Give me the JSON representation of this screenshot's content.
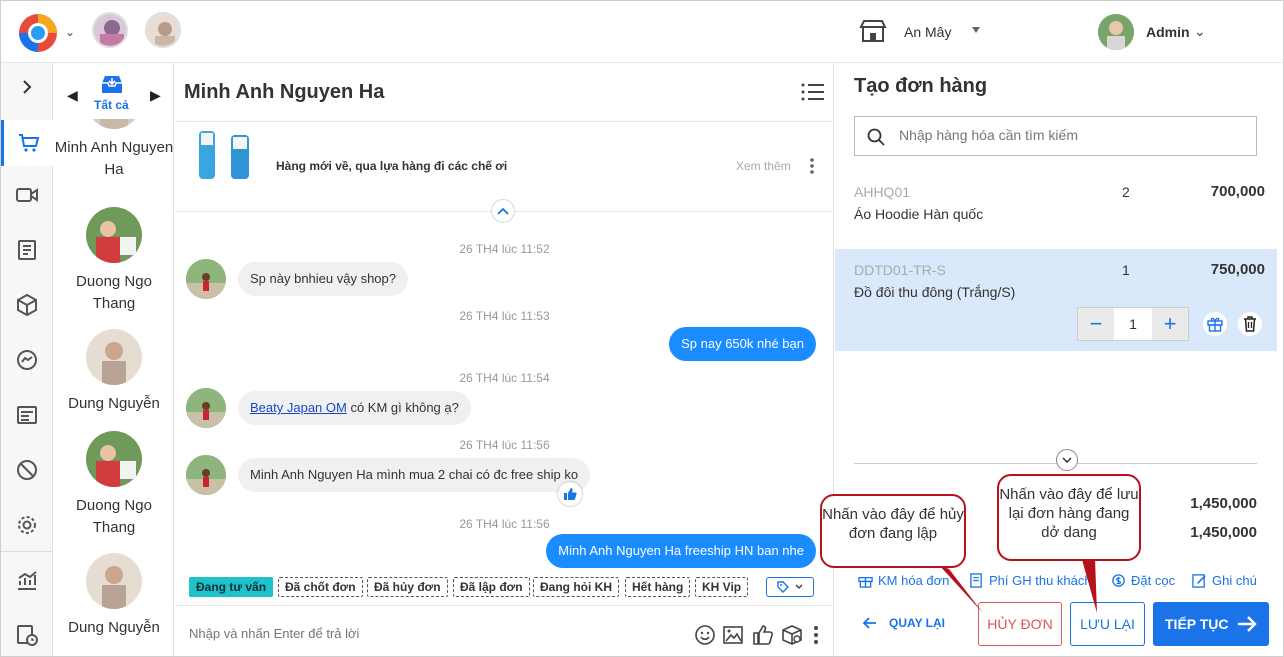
{
  "header": {
    "store_name": "An Mây",
    "admin_name": "Admin"
  },
  "conversations": {
    "filter_label": "Tất cả",
    "items": [
      {
        "name": "Minh Anh Nguyen Ha"
      },
      {
        "name": "Duong Ngo Thang"
      },
      {
        "name": "Dung Nguyễn"
      },
      {
        "name": "Duong Ngo Thang"
      },
      {
        "name": "Dung Nguyễn"
      }
    ]
  },
  "chat": {
    "title": "Minh Anh Nguyen Ha",
    "post_text": "Hàng mới về, qua lựa hàng đi các chế ơi",
    "post_more": "Xem thêm",
    "messages": [
      {
        "time": "26 TH4 lúc 11:52",
        "text": "Sp này bnhieu vậy shop?"
      },
      {
        "time": "26 TH4 lúc 11:53",
        "text": "Sp nay 650k nhé bạn"
      },
      {
        "time": "26 TH4 lúc 11:54",
        "link": "Beaty Japan OM",
        "text": "có KM gì không ạ?"
      },
      {
        "time": "26 TH4 lúc 11:56",
        "text": "Minh Anh Nguyen Ha mình mua 2 chai có đc free ship ko"
      },
      {
        "time": "26 TH4 lúc 11:56",
        "text": "Minh Anh Nguyen Ha freeship HN ban nhe"
      }
    ],
    "tags": [
      "Đang tư vấn",
      "Đã chốt đơn",
      "Đã hủy đơn",
      "Đã lập đơn",
      "Đang hỏi KH",
      "Hết hàng",
      "KH Vip"
    ],
    "reply_placeholder": "Nhập và nhấn Enter để trả lời"
  },
  "order": {
    "title": "Tạo đơn hàng",
    "search_placeholder": "Nhập hàng hóa cần tìm kiếm",
    "products": [
      {
        "code": "AHHQ01",
        "name": "Áo Hoodie Hàn quốc",
        "qty": "2",
        "price": "700,000"
      },
      {
        "code": "DDTD01-TR-S",
        "name": "Đồ đôi thu đông (Trắng/S)",
        "qty": "1",
        "price": "750,000"
      }
    ],
    "stepper_value": "1",
    "totals": [
      "1,450,000",
      "1,450,000"
    ],
    "options": {
      "promo": "KM hóa đơn",
      "shipping": "Phí GH thu khách",
      "deposit": "Đặt cọc",
      "note": "Ghi chú"
    },
    "back_label": "QUAY LẠI",
    "cancel_label": "HỦY ĐƠN",
    "save_label": "LƯU LẠI",
    "next_label": "TIẾP TỤC"
  },
  "callouts": {
    "cancel_hint": "Nhấn vào đây để hủy đơn đang lập",
    "save_hint": "Nhấn vào đây để lưu lại đơn hàng đang dở dang"
  },
  "colors": {
    "accent": "#1a73e8",
    "outgoing_bubble": "#1a8cff",
    "active_tag": "#1ec2c8",
    "cancel": "#e05555",
    "callout_border": "#b5121b"
  }
}
